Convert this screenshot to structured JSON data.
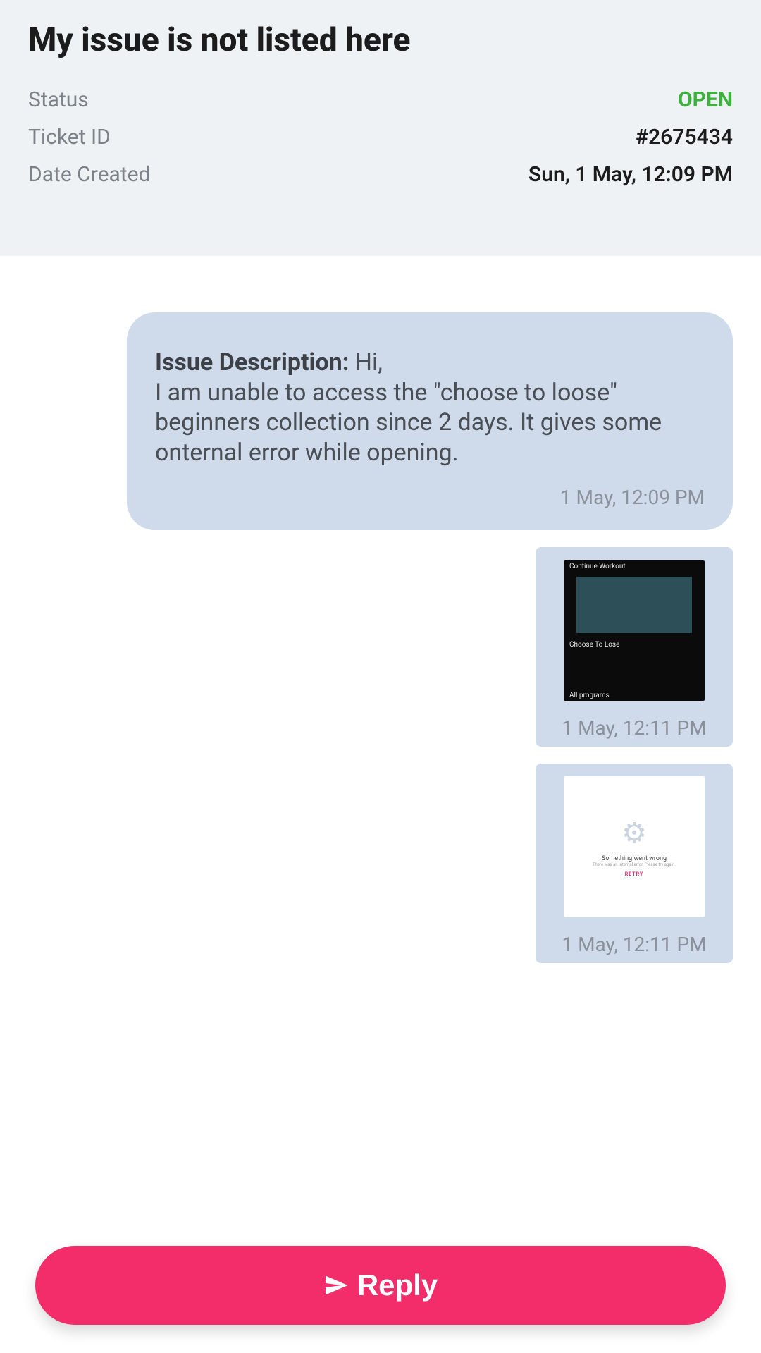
{
  "header": {
    "title": "My issue is not listed here",
    "status_label": "Status",
    "status_value": "OPEN",
    "ticket_label": "Ticket ID",
    "ticket_value": "#2675434",
    "date_label": "Date Created",
    "date_value": "Sun, 1 May, 12:09 PM"
  },
  "messages": {
    "first": {
      "prefix": "Issue Description: ",
      "body": "Hi,\nI am unable to access the \"choose to loose\" beginners collection since 2 days. It gives some onternal error while opening.",
      "timestamp": "1 May, 12:09 PM"
    },
    "attachments": [
      {
        "thumb_top": "Continue Workout",
        "thumb_mid": "Choose To Lose",
        "thumb_bottom": "All programs",
        "timestamp": "1 May, 12:11 PM"
      },
      {
        "err_title": "Something went wrong",
        "err_sub": "There was an internal error. Please try again.",
        "err_retry": "RETRY",
        "timestamp": "1 May, 12:11 PM"
      }
    ]
  },
  "footer": {
    "reply_label": "Reply"
  }
}
